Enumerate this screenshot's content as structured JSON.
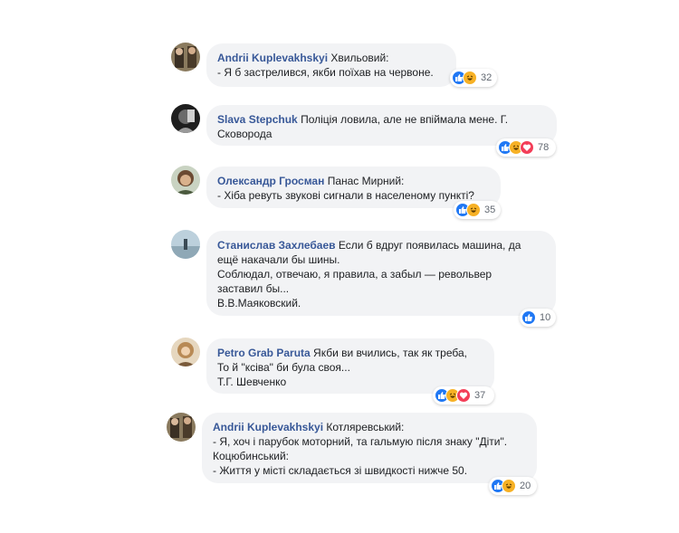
{
  "colors": {
    "author": "#385898",
    "bubble": "#f2f3f5",
    "like": "#2078f4",
    "haha": "#f7b125",
    "love": "#f33e58"
  },
  "comments": [
    {
      "author": "Andrii Kuplevakhskyi",
      "lines": [
        "Хвильовий:",
        "- Я б застрелився, якби поїхав на червоне."
      ],
      "reactions": [
        "like-icon",
        "haha-icon"
      ],
      "count": "32"
    },
    {
      "author": "Slava Stepchuk",
      "lines": [
        "Поліція ловила, але не впіймала мене. Г.",
        "Сковорода"
      ],
      "reactions": [
        "like-icon",
        "haha-icon",
        "love-icon"
      ],
      "count": "78"
    },
    {
      "author": "Олександр Гросман",
      "lines": [
        "Панас Мирний:",
        "- Хіба ревуть звукові сигнали в населеному пункті?"
      ],
      "reactions": [
        "like-icon",
        "haha-icon"
      ],
      "count": "35"
    },
    {
      "author": "Станислав Захлебаев",
      "lines": [
        "Если б вдруг появилась машина, да",
        "ещё накачали бы шины.",
        "Соблюдал, отвечаю, я правила, а забыл — револьвер",
        "заставил бы...",
        "В.В.Маяковский."
      ],
      "reactions": [
        "like-icon"
      ],
      "count": "10"
    },
    {
      "author": "Petro Grab Paruta",
      "lines": [
        "Якби ви вчились, так як треба,",
        "То й \"ксіва\" би була своя...",
        "Т.Г. Шевченко"
      ],
      "reactions": [
        "like-icon",
        "haha-icon",
        "love-icon"
      ],
      "count": "37"
    },
    {
      "author": "Andrii Kuplevakhskyi",
      "lines": [
        "Котляревський:",
        "- Я, хоч і парубок моторний, та гальмую після знаку \"Діти\".",
        "Коцюбинський:",
        "- Життя у місті складається зі швидкості нижче 50."
      ],
      "reactions": [
        "like-icon",
        "haha-icon"
      ],
      "count": "20"
    }
  ]
}
